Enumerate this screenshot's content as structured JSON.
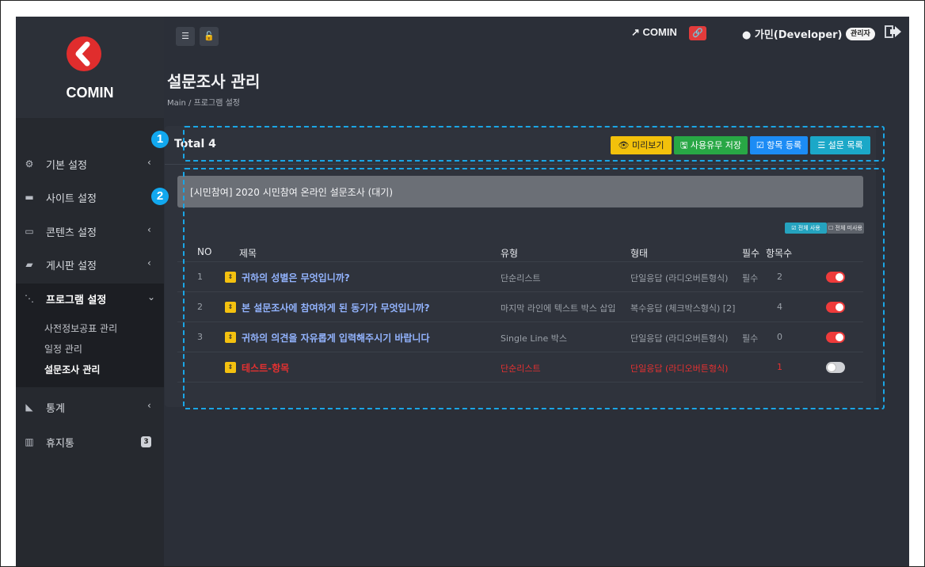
{
  "brand": {
    "name": "COMIN",
    "logo_icon": "comin-logo-icon",
    "color": "#e02d2d"
  },
  "sidebar": {
    "items": [
      {
        "label": "기본 설정",
        "icon": "gears-icon",
        "arrow": "‹"
      },
      {
        "label": "사이트 설정",
        "icon": "credit-card-icon",
        "arrow": ""
      },
      {
        "label": "콘텐츠 설정",
        "icon": "keyboard-icon",
        "arrow": "‹"
      },
      {
        "label": "게시판 설정",
        "icon": "comments-icon",
        "arrow": "‹"
      },
      {
        "label": "프로그램 설정",
        "icon": "sitemap-icon",
        "arrow": "⌄"
      },
      {
        "label": "통계",
        "icon": "area-chart-icon",
        "arrow": "‹"
      },
      {
        "label": "휴지통",
        "icon": "trash-icon",
        "count": "3"
      }
    ],
    "sub_items": [
      {
        "label": "사전정보공표 관리"
      },
      {
        "label": "일정 관리"
      },
      {
        "label": "설문조사 관리"
      }
    ]
  },
  "header": {
    "link_label": "COMIN",
    "user_label": "가민(Developer)",
    "role_badge": "관리자"
  },
  "page": {
    "title": "설문조사 관리",
    "breadcrumb": "Main  /  프로그램 설정"
  },
  "panel": {
    "total": "Total 4",
    "buttons": {
      "preview": "👁 미리보기",
      "save_usage": "🖫 사용유무 저장",
      "register_item": "☑ 항목 등록",
      "survey_list": "☰ 설문 목록"
    },
    "colors": {
      "preview": "#f3c10b",
      "save_usage": "#28a745",
      "register_item": "#1c8cf5",
      "survey_list": "#1ba8c8"
    },
    "survey_title": "[시민참여] 2020 시민참여 온라인 설문조사 (대기)",
    "toggle_all_label": "☑ 전체 사용",
    "untoggle_all_label": "☐ 전체 미사용"
  },
  "table": {
    "headers": {
      "no": "NO",
      "title": "제목",
      "type": "유형",
      "form": "형태",
      "required": "필수",
      "count": "항목수"
    },
    "rows": [
      {
        "no": "1",
        "title": "귀하의 성별은 무엇입니까?",
        "type": "단순리스트",
        "form": "단일응답 (라디오버튼형식)",
        "required": "필수",
        "count": "2",
        "enabled": true
      },
      {
        "no": "2",
        "title": "본 설문조사에 참여하게 된 동기가 무엇입니까?",
        "type": "마지막 라인에 텍스트 박스 삽입",
        "form": "복수응답 (체크박스형식) [2]",
        "required": "",
        "count": "4",
        "enabled": true
      },
      {
        "no": "3",
        "title": "귀하의 의견을 자유롭게 입력해주시기 바랍니다",
        "type": "Single Line 박스",
        "form": "단일응답 (라디오버튼형식)",
        "required": "필수",
        "count": "0",
        "enabled": true
      },
      {
        "no": "",
        "title": "테스트-항목",
        "type": "단순리스트",
        "form": "단일응답 (라디오버튼형식)",
        "required": "",
        "count": "1",
        "enabled": false
      }
    ]
  },
  "annotations": {
    "marker_1": "1",
    "marker_2": "2",
    "color": "#1aa6e6"
  }
}
